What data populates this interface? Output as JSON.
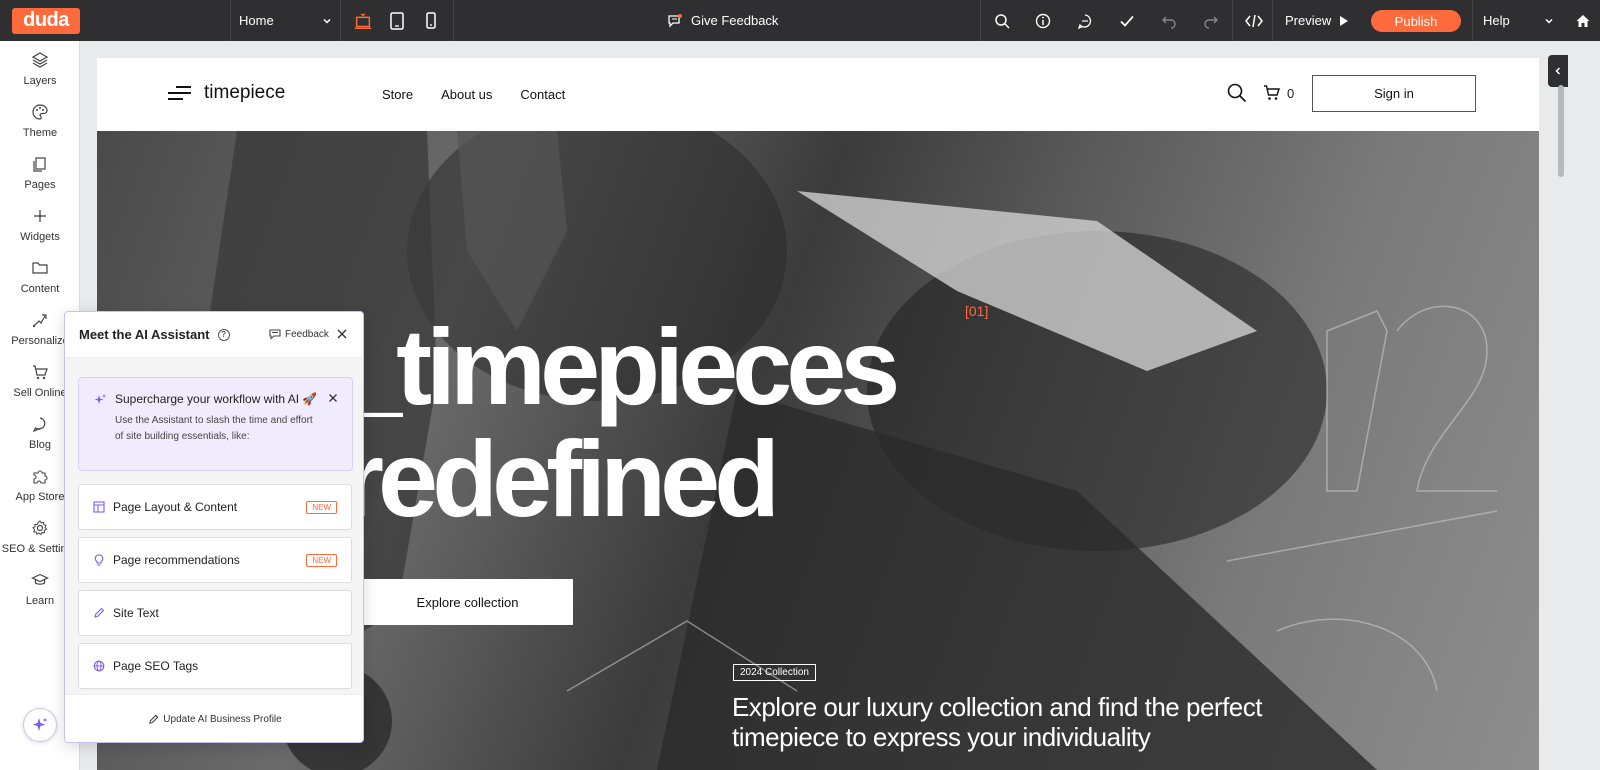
{
  "app": {
    "logo": "duda",
    "accent": "#ff6a3d"
  },
  "topbar": {
    "page_select": "Home",
    "give_feedback": "Give Feedback",
    "preview": "Preview",
    "publish": "Publish",
    "help": "Help"
  },
  "sidebar": {
    "items": [
      {
        "label": "Layers",
        "icon": "layers-icon"
      },
      {
        "label": "Theme",
        "icon": "palette-icon"
      },
      {
        "label": "Pages",
        "icon": "pages-icon"
      },
      {
        "label": "Widgets",
        "icon": "plus-icon"
      },
      {
        "label": "Content",
        "icon": "folder-icon"
      },
      {
        "label": "Personalize",
        "icon": "personalize-icon"
      },
      {
        "label": "Sell Online",
        "icon": "cart-icon"
      },
      {
        "label": "Blog",
        "icon": "chat-icon"
      },
      {
        "label": "App Store",
        "icon": "puzzle-icon"
      },
      {
        "label": "SEO & Settings",
        "icon": "gear-icon"
      },
      {
        "label": "Learn",
        "icon": "graduation-icon"
      }
    ]
  },
  "site": {
    "brand": "timepiece",
    "nav": [
      "Store",
      "About us",
      "Contact"
    ],
    "cart_count": "0",
    "sign_in": "Sign in",
    "hero_index": "[01]",
    "hero_line1": "_timepieces",
    "hero_line2": "redefined",
    "explore": "Explore collection",
    "collection_badge": "2024 Collection",
    "hero_sub": "Explore our luxury collection and find the perfect timepiece to express your individuality"
  },
  "ai_panel": {
    "title": "Meet the AI Assistant",
    "feedback": "Feedback",
    "promo_title": "Supercharge your workflow with AI 🚀",
    "promo_text": "Use the Assistant to slash the time and effort of site building essentials, like:",
    "options": [
      {
        "label": "Page Layout & Content",
        "badge": "NEW"
      },
      {
        "label": "Page recommendations",
        "badge": "NEW"
      },
      {
        "label": "Site Text",
        "badge": ""
      },
      {
        "label": "Page SEO Tags",
        "badge": ""
      }
    ],
    "footer": "Update AI Business Profile"
  }
}
